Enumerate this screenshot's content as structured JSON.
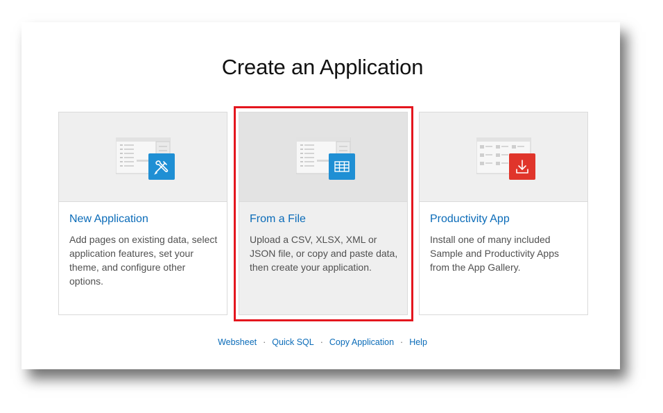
{
  "page": {
    "title": "Create an Application"
  },
  "cards": [
    {
      "title": "New Application",
      "description": "Add pages on existing data, select application features, set your theme, and configure other options.",
      "icon": "wrench-pencil-icon",
      "icon_color": "#1f8fd4"
    },
    {
      "title": "From a File",
      "description": "Upload a CSV, XLSX, XML or JSON file, or copy and paste data, then create your application.",
      "icon": "table-grid-icon",
      "icon_color": "#1f8fd4",
      "selected": true
    },
    {
      "title": "Productivity App",
      "description": "Install one of many included Sample and Productivity Apps from the App Gallery.",
      "icon": "download-icon",
      "icon_color": "#e0352b"
    }
  ],
  "footer": {
    "links": [
      "Websheet",
      "Quick SQL",
      "Copy Application",
      "Help"
    ],
    "separator": "·"
  },
  "colors": {
    "link": "#0a6bb8",
    "highlight": "#e4161e"
  }
}
